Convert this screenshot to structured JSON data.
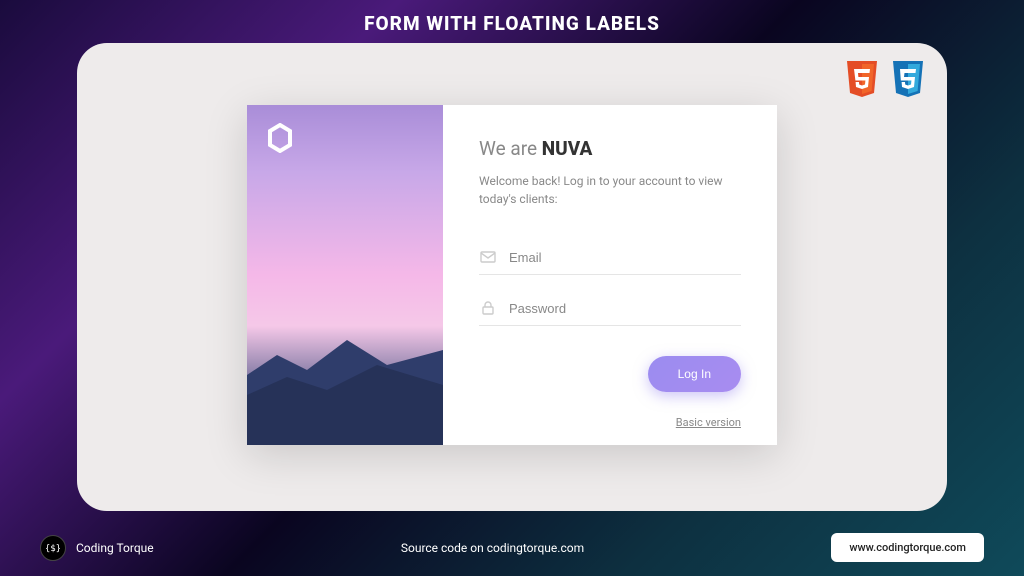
{
  "page": {
    "title": "FORM WITH FLOATING LABELS"
  },
  "badges": {
    "html": "HTML",
    "css": "CSS"
  },
  "card": {
    "heading_prefix": "We are ",
    "heading_brand": "NUVA",
    "subtext": "Welcome back! Log in to your account to view today's clients:",
    "email_placeholder": "Email",
    "password_placeholder": "Password",
    "login_button": "Log In",
    "basic_link": "Basic version"
  },
  "footer": {
    "brand": "Coding Torque",
    "center": "Source code on codingtorque.com",
    "url": "www.codingtorque.com"
  }
}
